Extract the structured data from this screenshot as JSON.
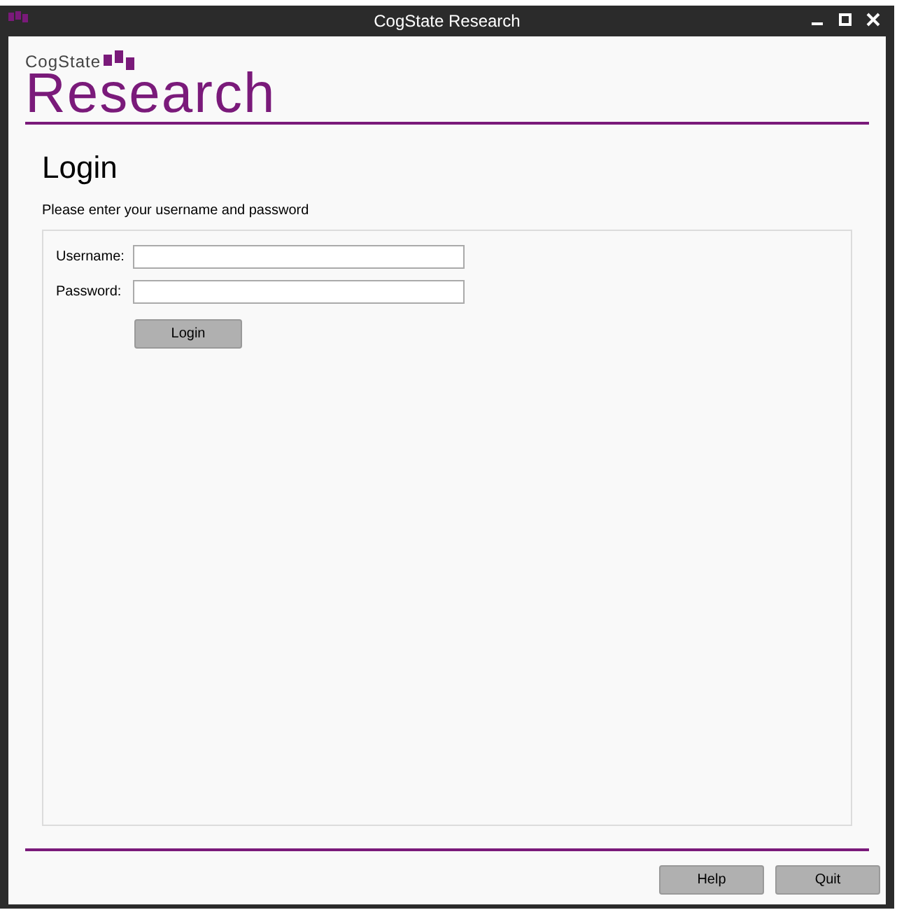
{
  "window": {
    "title": "CogState Research"
  },
  "logo": {
    "brand": "CogState",
    "product": "Research"
  },
  "heading": "Login",
  "instruction": "Please enter your username and password",
  "form": {
    "fields": [
      {
        "label": "Username:"
      },
      {
        "label": "Password:"
      }
    ],
    "submit": "Login"
  },
  "footer_buttons": [
    "Help",
    "Quit"
  ]
}
